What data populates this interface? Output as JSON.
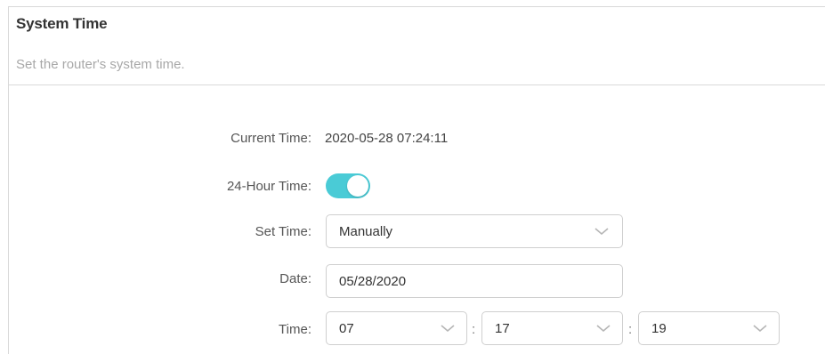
{
  "section": {
    "title": "System Time",
    "description": "Set the router's system time."
  },
  "form": {
    "current_time": {
      "label": "Current Time:",
      "value": "2020-05-28 07:24:11"
    },
    "hour24": {
      "label": "24-Hour Time:",
      "enabled": true,
      "accent_color": "#4acbd6"
    },
    "set_time": {
      "label": "Set Time:",
      "selected": "Manually"
    },
    "date": {
      "label": "Date:",
      "value": "05/28/2020"
    },
    "time": {
      "label": "Time:",
      "separator": ":",
      "hour": "07",
      "minute": "17",
      "second": "19"
    }
  },
  "icons": {
    "dropdown": "chevron-down-icon"
  }
}
